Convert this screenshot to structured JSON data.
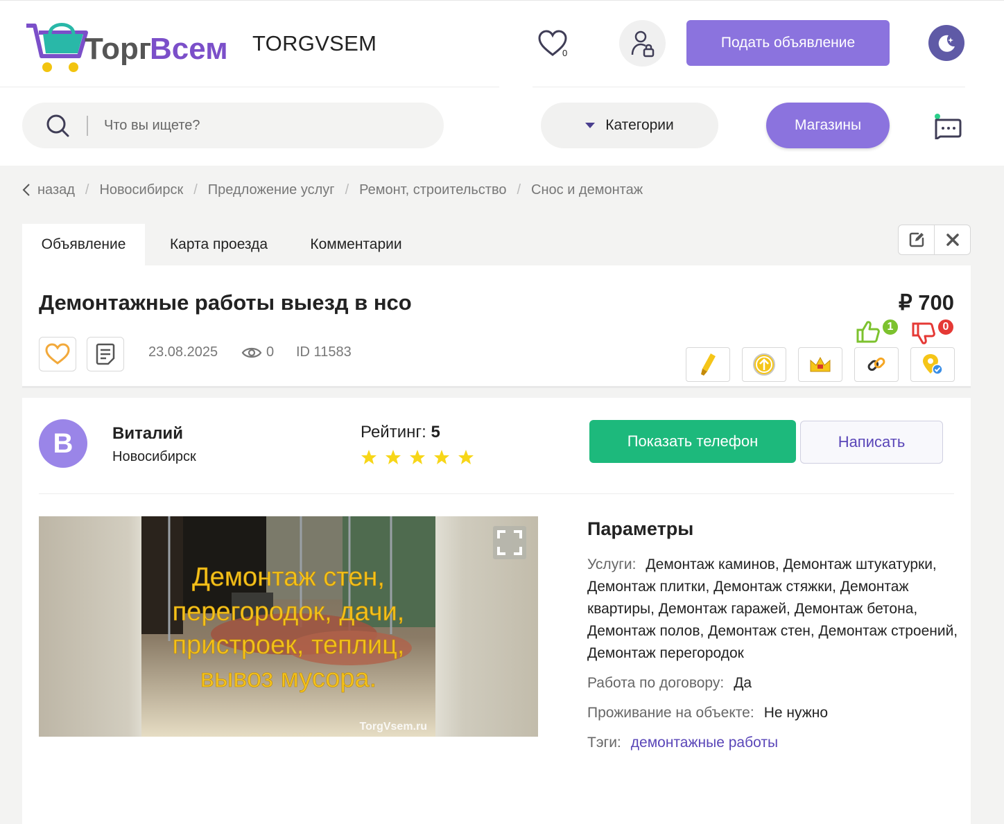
{
  "header": {
    "brand_title": "TORGVSEM",
    "logo_text": "ТоргВсем",
    "favorites_count": "0",
    "post_ad_label": "Подать объявление",
    "search_placeholder": "Что вы ищете?",
    "categories_label": "Категории",
    "shops_label": "Магазины"
  },
  "breadcrumb": {
    "items": [
      "назад",
      "Новосибирск",
      "Предложение услуг",
      "Ремонт, строительство",
      "Снос и демонтаж"
    ]
  },
  "tabs": [
    {
      "label": "Объявление",
      "active": true
    },
    {
      "label": "Карта проезда",
      "active": false
    },
    {
      "label": "Комментарии",
      "active": false
    }
  ],
  "ad": {
    "title": "Демонтажные работы выезд в нсо",
    "price": "₽ 700",
    "likes": "1",
    "dislikes": "0",
    "date": "23.08.2025",
    "views": "0",
    "id_label": "ID 11583"
  },
  "seller": {
    "initial": "В",
    "name": "Виталий",
    "city": "Новосибирск",
    "rating_label": "Рейтинг:",
    "rating_value": "5",
    "stars": 5,
    "show_phone_label": "Показать телефон",
    "write_label": "Написать"
  },
  "photo": {
    "caption_lines": [
      "Демонтаж стен,",
      "перегородок, дачи,",
      "пристроек, теплиц,",
      "вывоз мусора."
    ],
    "watermark": "TorgVsem.ru"
  },
  "params": {
    "heading": "Параметры",
    "services_key": "Услуги:",
    "services_value": "Демонтаж каминов, Демонтаж штукатурки, Демонтаж плитки, Демонтаж стяжки, Демонтаж квартиры, Демонтаж гаражей, Демонтаж бетона, Демонтаж полов, Демонтаж стен, Демонтаж строений, Демонтаж перегородок",
    "contract_key": "Работа по договору:",
    "contract_value": "Да",
    "living_key": "Проживание на объекте:",
    "living_value": "Не нужно",
    "tags_key": "Тэги:",
    "tags_value": "демонтажные работы"
  },
  "colors": {
    "accent": "#8b73de",
    "phone_button": "#1db97c",
    "like": "#7cc22e",
    "dislike": "#e53935",
    "star": "#f7d618"
  }
}
